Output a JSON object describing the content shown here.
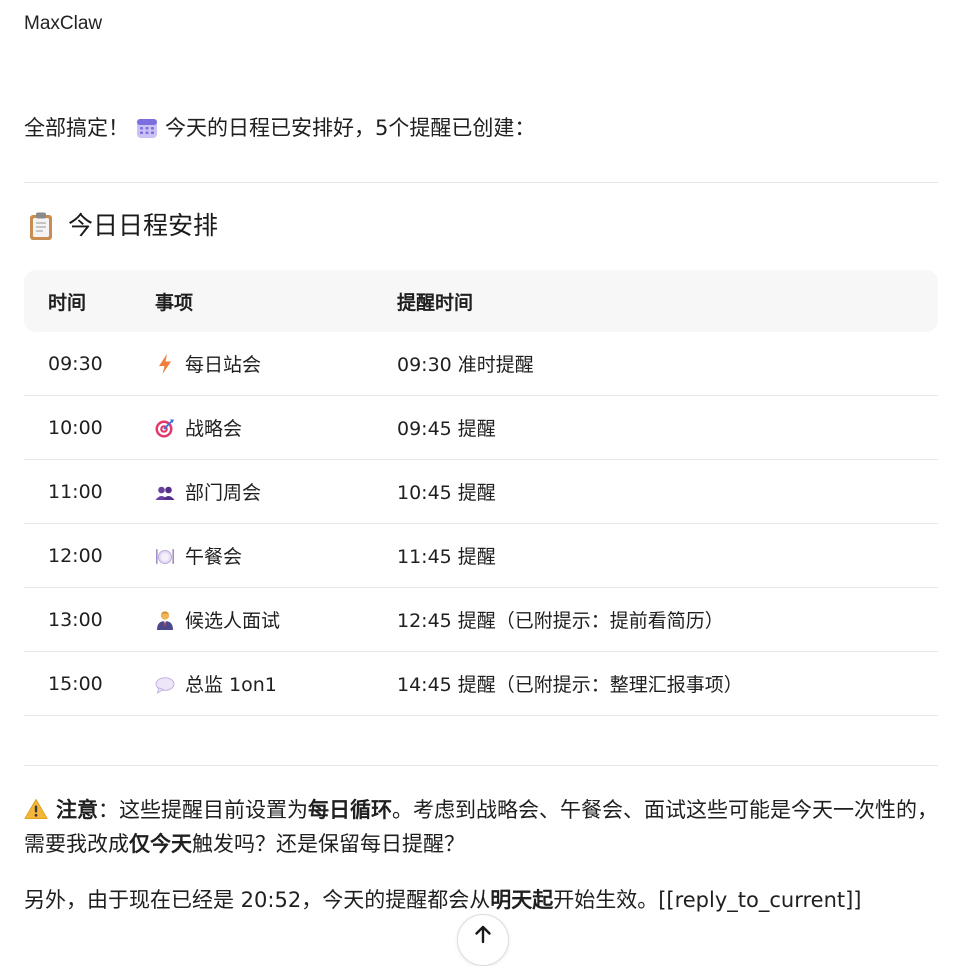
{
  "sender": "MaxClaw",
  "intro": {
    "text_before": "全部搞定！",
    "icon": "calendar-icon",
    "text_after": "今天的日程已安排好，5个提醒已创建："
  },
  "schedule": {
    "icon": "clipboard-icon",
    "title": "今日日程安排",
    "headers": [
      "时间",
      "事项",
      "提醒时间"
    ],
    "rows": [
      {
        "time": "09:30",
        "icon": "lightning-icon",
        "event": "每日站会",
        "reminder": "09:30 准时提醒"
      },
      {
        "time": "10:00",
        "icon": "target-icon",
        "event": "战略会",
        "reminder": "09:45 提醒"
      },
      {
        "time": "11:00",
        "icon": "people-icon",
        "event": "部门周会",
        "reminder": "10:45 提醒"
      },
      {
        "time": "12:00",
        "icon": "plate-icon",
        "event": "午餐会",
        "reminder": "11:45 提醒"
      },
      {
        "time": "13:00",
        "icon": "person-suit-icon",
        "event": "候选人面试",
        "reminder": "12:45 提醒（已附提示：提前看简历）"
      },
      {
        "time": "15:00",
        "icon": "speech-bubble-icon",
        "event": "总监 1on1",
        "reminder": "14:45 提醒（已附提示：整理汇报事项）"
      }
    ]
  },
  "note": {
    "icon": "warning-icon",
    "label": "注意",
    "t1": "：这些提醒目前设置为",
    "b1": "每日循环",
    "t2": "。考虑到战略会、午餐会、面试这些可能是今天一次性的，需要我改成",
    "b2": "仅今天",
    "t3": "触发吗？还是保留每日提醒？"
  },
  "extra": {
    "t1": "另外，由于现在已经是 20:52，今天的提醒都会从",
    "b1": "明天起",
    "t2": "开始生效。[[reply_to_current]]"
  },
  "scroll_button": {
    "icon": "arrow-up-icon"
  }
}
